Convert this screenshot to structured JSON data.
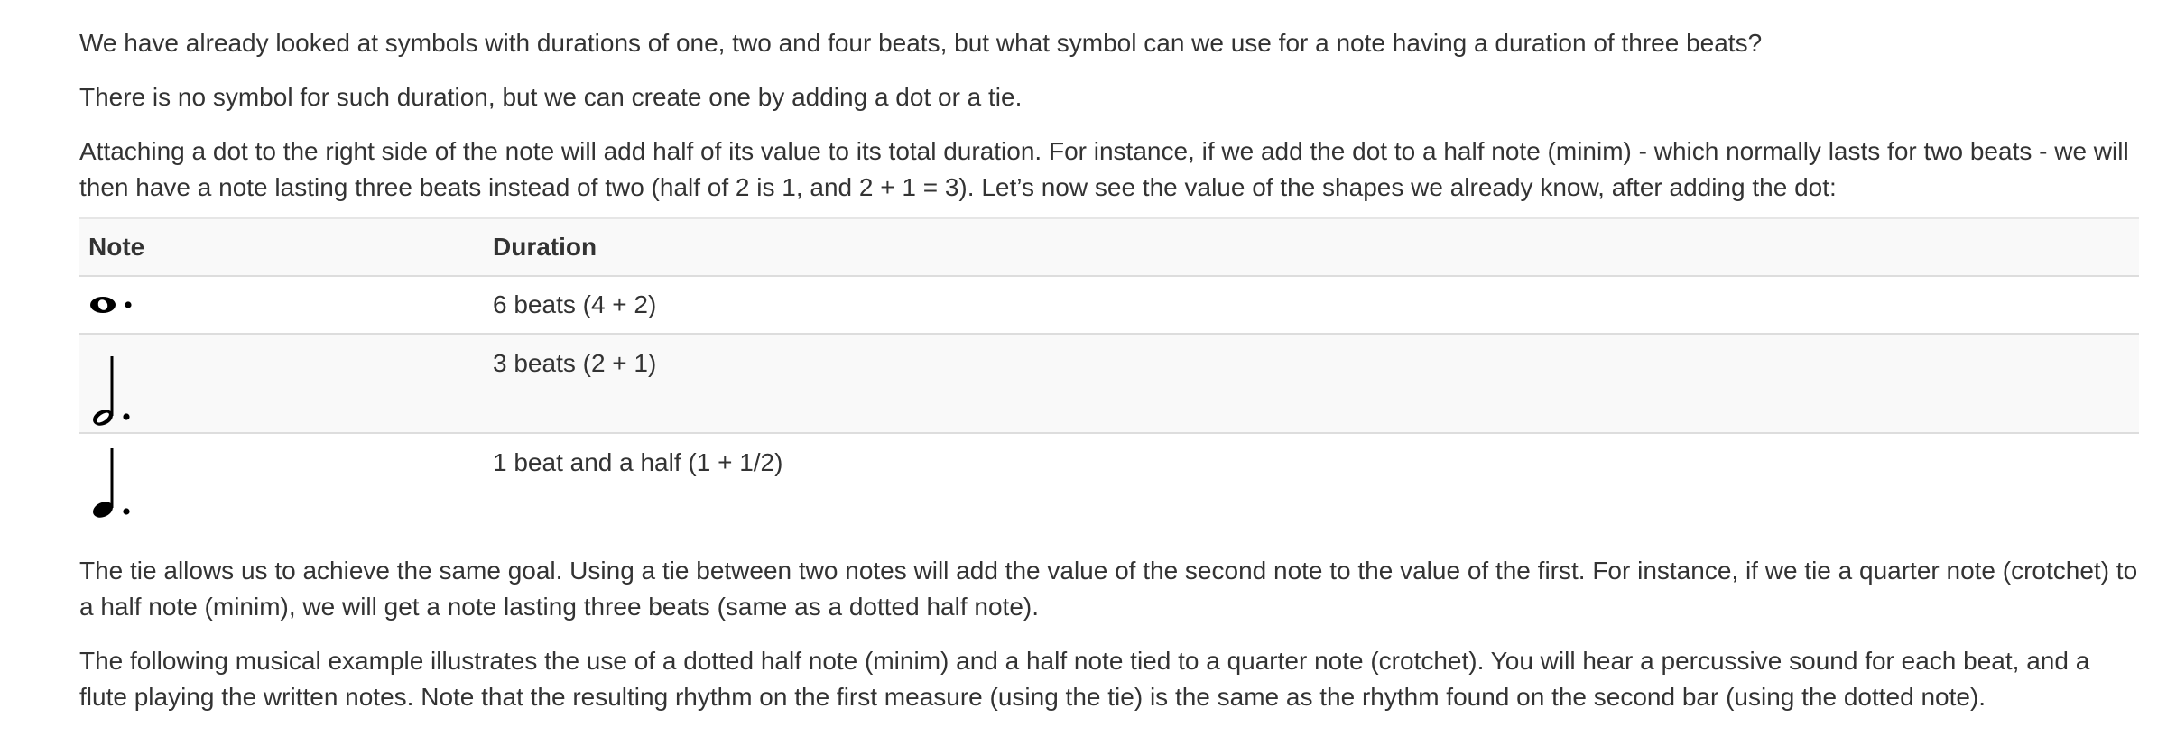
{
  "paragraphs": {
    "intro_question": "We have already looked at symbols with durations of one, two and four beats, but what symbol can we use for a note having a duration of three beats?",
    "no_symbol": "There is no symbol for such duration, but we can create one by adding a dot or a tie.",
    "dot_explanation": "Attaching a dot to the right side of the note will add half of its value to its total duration. For instance, if we add the dot to a half note (minim) - which normally lasts for two beats - we will then have a note lasting three beats instead of two (half of 2 is 1, and 2 + 1 = 3).  Let’s now see the value of the shapes we already know, after adding the dot:",
    "tie_explanation": "The tie allows us to achieve the same goal. Using a tie between two notes will add the value of the second note to the value of the first. For instance, if we tie a quarter note (crotchet) to a half note (minim), we will get a note lasting three beats (same as a dotted half note).",
    "example_explanation": "The following musical example illustrates the use of a dotted half note (minim) and a half note tied to a quarter note (crotchet). You will hear a percussive sound for each beat, and a flute playing the written notes. Note that the resulting rhythm on the first measure (using the tie) is the same as the rhythm found on the second bar (using the dotted note)."
  },
  "table": {
    "headers": {
      "note": "Note",
      "duration": "Duration"
    },
    "rows": [
      {
        "note_icon": "dotted-whole-note-icon",
        "duration": "6 beats (4 + 2)"
      },
      {
        "note_icon": "dotted-half-note-icon",
        "duration": "3 beats (2 + 1)"
      },
      {
        "note_icon": "dotted-quarter-note-icon",
        "duration": "1 beat and a half (1 + 1/2)"
      }
    ]
  },
  "colors": {
    "text": "#333333",
    "row_stripe": "#f9f9f9",
    "border": "#dddddd",
    "note": "#000000"
  }
}
